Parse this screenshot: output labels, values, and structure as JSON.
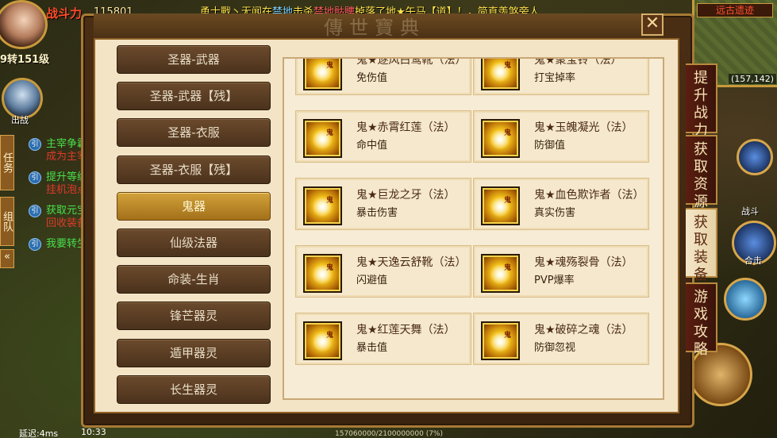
{
  "player": {
    "name": "战斗力",
    "power": "115801",
    "level": "9转151级",
    "partner_label": "出战"
  },
  "announcement": {
    "line1_pre": "勇士戰丶无闻在",
    "line1_place": "禁地",
    "line1_mid": "击杀",
    "line1_monster": "禁地骷髏",
    "line1_post": "掉落了地★午马【道】！，简直羡煞旁人",
    "line2": "！"
  },
  "side_tabs": {
    "task": "任务",
    "team": "组队",
    "collapse": "«"
  },
  "quests": [
    {
      "title": "主宰争霸",
      "sub": "成为主宰"
    },
    {
      "title": "提升等级",
      "sub": "挂机泡点"
    },
    {
      "title": "获取元宝",
      "sub": "回收装备"
    },
    {
      "title": "我要转生",
      "sub": ""
    }
  ],
  "minimap": {
    "title": "远古遗迹",
    "coords": "(157,142)"
  },
  "right_hud": {
    "battle_label": "战斗",
    "combo_label": "合击"
  },
  "dialog": {
    "title": "傳世寶典",
    "close": "✕"
  },
  "categories": [
    {
      "label": "圣器-武器",
      "active": false
    },
    {
      "label": "圣器-武器【残】",
      "active": false
    },
    {
      "label": "圣器-衣服",
      "active": false
    },
    {
      "label": "圣器-衣服【残】",
      "active": false
    },
    {
      "label": "鬼器",
      "active": true
    },
    {
      "label": "仙级法器",
      "active": false
    },
    {
      "label": "命装-生肖",
      "active": false
    },
    {
      "label": "锋芒器灵",
      "active": false
    },
    {
      "label": "遁甲器灵",
      "active": false
    },
    {
      "label": "长生器灵",
      "active": false
    }
  ],
  "items": [
    {
      "name": "鬼★逐风白鹭靴（法）",
      "attr": "免伤值",
      "icon": "ghost-boots-icon"
    },
    {
      "name": "鬼★聚宝铃（法）",
      "attr": "打宝掉率",
      "icon": "ghost-bell-icon"
    },
    {
      "name": "鬼★赤霄红莲（法）",
      "attr": "命中值",
      "icon": "ghost-lotus-icon"
    },
    {
      "name": "鬼★玉魄凝光（法）",
      "attr": "防御值",
      "icon": "ghost-jade-icon"
    },
    {
      "name": "鬼★巨龙之牙（法）",
      "attr": "暴击伤害",
      "icon": "ghost-dragon-fang-icon"
    },
    {
      "name": "鬼★血色欺诈者（法）",
      "attr": "真实伤害",
      "icon": "ghost-blood-icon"
    },
    {
      "name": "鬼★天逸云舒靴（法）",
      "attr": "闪避值",
      "icon": "ghost-cloud-boots-icon"
    },
    {
      "name": "鬼★魂殇裂骨（法）",
      "attr": "PVP爆率",
      "icon": "ghost-bone-icon"
    },
    {
      "name": "鬼★红莲天舞（法）",
      "attr": "暴击值",
      "icon": "ghost-red-lotus-icon"
    },
    {
      "name": "鬼★破碎之魂（法）",
      "attr": "防御忽视",
      "icon": "ghost-soul-icon"
    }
  ],
  "vertical_tabs": [
    {
      "label": "提升战力",
      "active": false
    },
    {
      "label": "获取资源",
      "active": false
    },
    {
      "label": "获取装备",
      "active": true
    },
    {
      "label": "游戏攻略",
      "active": false
    }
  ],
  "status": {
    "latency": "延迟:4ms",
    "clock": "10:33",
    "exp": "157060000/2100000000 (7%)"
  },
  "colors": {
    "accent_gold": "#d2a23a",
    "panel_bg": "#f7ecd5",
    "frame": "#a77a36",
    "announce": "#ffe24a"
  }
}
